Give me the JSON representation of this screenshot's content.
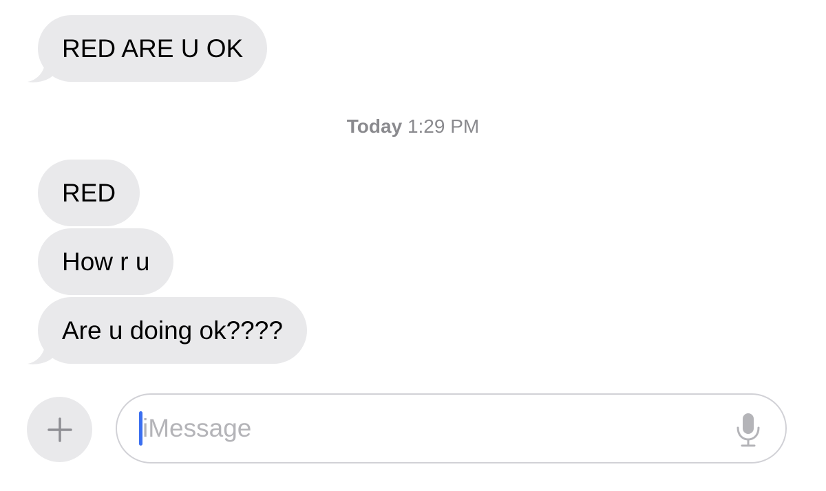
{
  "conversation": {
    "messages": [
      {
        "text": "RED ARE U OK",
        "direction": "incoming"
      },
      {
        "text": "RED",
        "direction": "incoming"
      },
      {
        "text": "How r u",
        "direction": "incoming"
      },
      {
        "text": "Are u doing ok????",
        "direction": "incoming"
      }
    ],
    "timestamp": {
      "day": "Today",
      "time": "1:29 PM"
    }
  },
  "composer": {
    "placeholder": "iMessage",
    "plus_icon": "plus-icon",
    "mic_icon": "microphone-icon"
  },
  "colors": {
    "bubble_incoming": "#e9e9eb",
    "timestamp": "#8a8a8e",
    "caret": "#3b6ff0",
    "placeholder": "#b4b4b8"
  }
}
